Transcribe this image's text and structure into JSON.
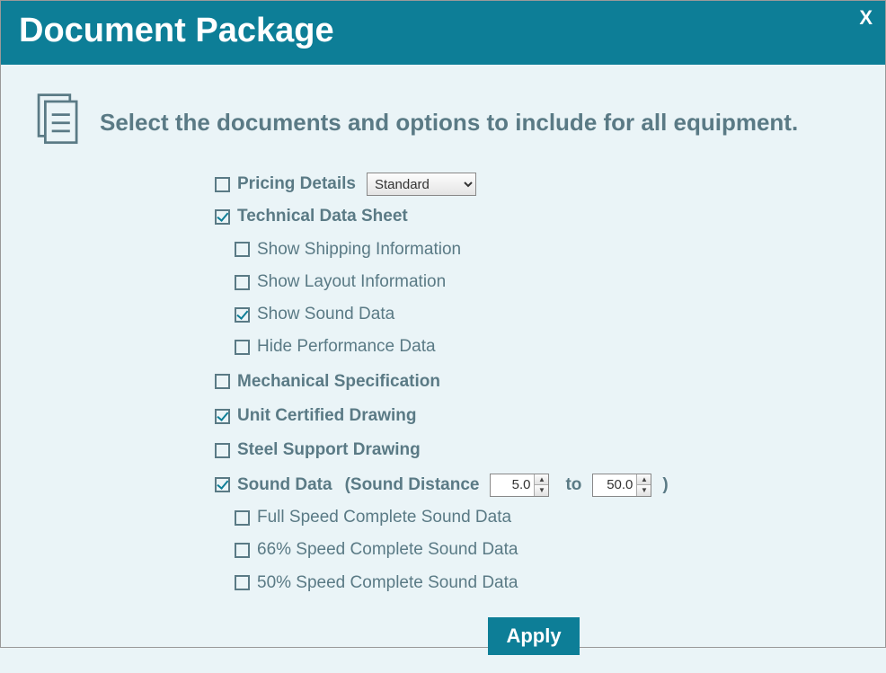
{
  "title": "Document Package",
  "close_label": "X",
  "instruction": "Select the documents and options to include for all equipment.",
  "pricing": {
    "label": "Pricing Details",
    "checked": false,
    "select_value": "Standard"
  },
  "technical": {
    "label": "Technical Data Sheet",
    "checked": true,
    "subs": {
      "shipping": {
        "label": "Show Shipping Information",
        "checked": false
      },
      "layout": {
        "label": "Show Layout Information",
        "checked": false
      },
      "sound": {
        "label": "Show Sound Data",
        "checked": true
      },
      "hideperf": {
        "label": "Hide Performance Data",
        "checked": false
      }
    }
  },
  "mechanical": {
    "label": "Mechanical Specification",
    "checked": false
  },
  "unitcert": {
    "label": "Unit Certified Drawing",
    "checked": true
  },
  "steel": {
    "label": "Steel Support Drawing",
    "checked": false
  },
  "sounddata": {
    "label": "Sound Data",
    "checked": true,
    "range_label_prefix": "(Sound Distance",
    "range_to": "to",
    "range_suffix": ")",
    "from": "5.0",
    "to_val": "50.0",
    "subs": {
      "full": {
        "label": "Full Speed Complete Sound Data",
        "checked": false
      },
      "p66": {
        "label": "66% Speed Complete Sound Data",
        "checked": false
      },
      "p50": {
        "label": "50% Speed Complete Sound Data",
        "checked": false
      }
    }
  },
  "apply_label": "Apply"
}
